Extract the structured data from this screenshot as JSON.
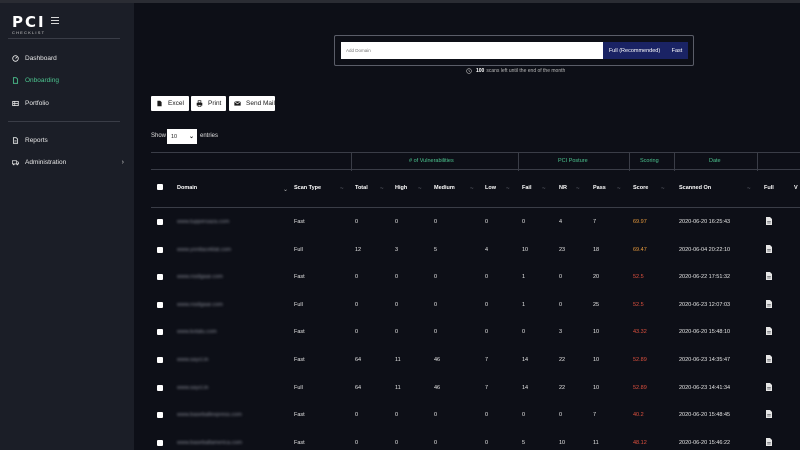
{
  "brand": {
    "logo": "PCI",
    "logo_sub": "CHECKLIST"
  },
  "sidebar": {
    "items": [
      {
        "label": "Dashboard",
        "icon": "dashboard-icon",
        "active": false
      },
      {
        "label": "Onboarding",
        "icon": "file-icon",
        "active": true
      },
      {
        "label": "Portfolio",
        "icon": "portfolio-icon",
        "active": false
      },
      {
        "label": "Reports",
        "icon": "report-icon",
        "active": false
      },
      {
        "label": "Administration",
        "icon": "truck-icon",
        "active": false
      }
    ]
  },
  "scan": {
    "placeholder": "Add Domain",
    "full_label": "Full (Recommended)",
    "fast_label": "Fast",
    "scans_count": "100",
    "scans_text": "scans left until the end of the month"
  },
  "toolbar": {
    "excel_label": "Excel",
    "print_label": "Print",
    "send_mail_label": "Send Mail"
  },
  "length": {
    "show_label": "Show",
    "value": "10",
    "entries_label": "entries"
  },
  "table": {
    "groups": {
      "vulnerabilities": "# of Vulnerabilities",
      "pci_posture": "PCI Posture",
      "scoring": "Scoring",
      "date": "Date"
    },
    "columns": {
      "domain": "Domain",
      "scan_type": "Scan Type",
      "total": "Total",
      "high": "High",
      "medium": "Medium",
      "low": "Low",
      "fail": "Fail",
      "nr": "NR",
      "pass": "Pass",
      "score": "Score",
      "scanned_on": "Scanned On",
      "full": "Full",
      "v": "V"
    },
    "rows": [
      {
        "domain": "www.tuppersaza.com",
        "scan_type": "Fast",
        "total": "0",
        "high": "0",
        "medium": "0",
        "low": "0",
        "fail": "0",
        "nr": "4",
        "pass": "7",
        "score": "69.97",
        "score_level": "orange",
        "scanned_on": "2020-06-20 16:25:43"
      },
      {
        "domain": "www.yonitaceklat.com",
        "scan_type": "Full",
        "total": "12",
        "high": "3",
        "medium": "5",
        "low": "4",
        "fail": "10",
        "nr": "23",
        "pass": "18",
        "score": "69.47",
        "score_level": "orange",
        "scanned_on": "2020-06-04 20:22:10"
      },
      {
        "domain": "www.rosilgaar.com",
        "scan_type": "Fast",
        "total": "0",
        "high": "0",
        "medium": "0",
        "low": "0",
        "fail": "1",
        "nr": "0",
        "pass": "20",
        "score": "52.5",
        "score_level": "red",
        "scanned_on": "2020-06-22 17:51:32"
      },
      {
        "domain": "www.rosilgaar.com",
        "scan_type": "Full",
        "total": "0",
        "high": "0",
        "medium": "0",
        "low": "0",
        "fail": "1",
        "nr": "0",
        "pass": "25",
        "score": "52.5",
        "score_level": "red",
        "scanned_on": "2020-06-23 12:07:03"
      },
      {
        "domain": "www.kotalu.com",
        "scan_type": "Fast",
        "total": "0",
        "high": "0",
        "medium": "0",
        "low": "0",
        "fail": "0",
        "nr": "3",
        "pass": "10",
        "score": "43.32",
        "score_level": "red",
        "scanned_on": "2020-06-20 15:48:10"
      },
      {
        "domain": "www.sayci.in",
        "scan_type": "Fast",
        "total": "64",
        "high": "11",
        "medium": "46",
        "low": "7",
        "fail": "14",
        "nr": "22",
        "pass": "10",
        "score": "52.89",
        "score_level": "red",
        "scanned_on": "2020-06-23 14:35:47"
      },
      {
        "domain": "www.sayci.in",
        "scan_type": "Full",
        "total": "64",
        "high": "11",
        "medium": "46",
        "low": "7",
        "fail": "14",
        "nr": "22",
        "pass": "10",
        "score": "52.89",
        "score_level": "red",
        "scanned_on": "2020-06-23 14:41:34"
      },
      {
        "domain": "www.baseballexpress.com",
        "scan_type": "Fast",
        "total": "0",
        "high": "0",
        "medium": "0",
        "low": "0",
        "fail": "0",
        "nr": "0",
        "pass": "7",
        "score": "40.2",
        "score_level": "red",
        "scanned_on": "2020-06-20 15:48:45"
      },
      {
        "domain": "www.baseballamerica.com",
        "scan_type": "Fast",
        "total": "0",
        "high": "0",
        "medium": "0",
        "low": "0",
        "fail": "5",
        "nr": "10",
        "pass": "11",
        "score": "48.12",
        "score_level": "red",
        "scanned_on": "2020-06-20 15:46:22"
      }
    ]
  },
  "colors": {
    "accent_green": "#4cc48f",
    "score_orange": "#e89a3c",
    "score_red": "#e0513f",
    "button_navy": "#1a2364"
  }
}
